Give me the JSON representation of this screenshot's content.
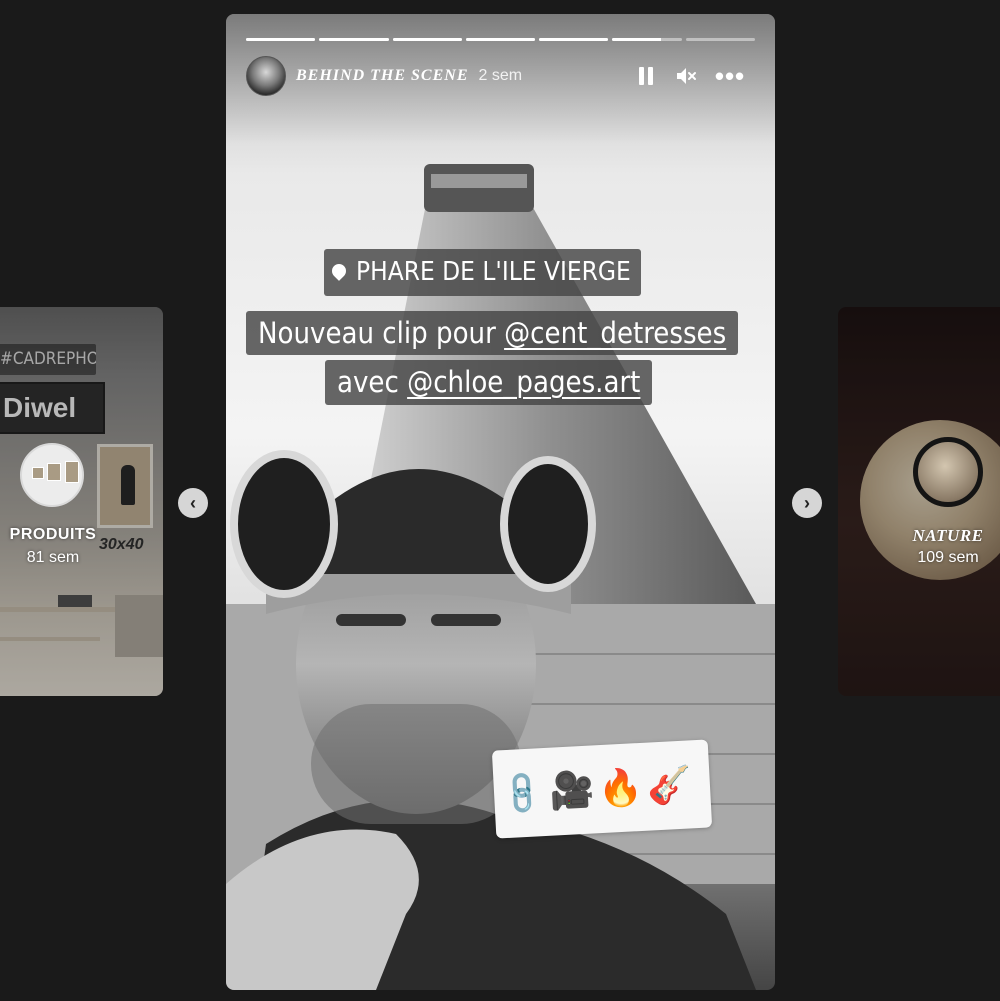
{
  "left_preview": {
    "hashtag": "#CADREPHOTO",
    "brand": "Diwel",
    "size_label": "30x40",
    "title": "PRODUITS",
    "time": "81 sem"
  },
  "right_preview": {
    "title": "NATURE",
    "time": "109 sem"
  },
  "nav": {
    "prev": "‹",
    "next": "›"
  },
  "story": {
    "user": "BEHIND THE SCENE",
    "time": "2 sem",
    "progress": [
      1,
      1,
      1,
      1,
      1,
      0.7,
      0
    ],
    "location": "PHARE DE L'ILE VIERGE",
    "caption_line1_text": "Nouveau clip pour ",
    "caption_line1_mention": "@cent_detresses",
    "caption_line2_text": "avec ",
    "caption_line2_mention": "@chloe_pages.art",
    "link_sticker": {
      "icon": "link-icon",
      "emojis": [
        "🎥",
        "🔥",
        "🎸"
      ]
    },
    "controls": {
      "pause": "pause-icon",
      "mute": "🔇",
      "more": "•••"
    }
  }
}
